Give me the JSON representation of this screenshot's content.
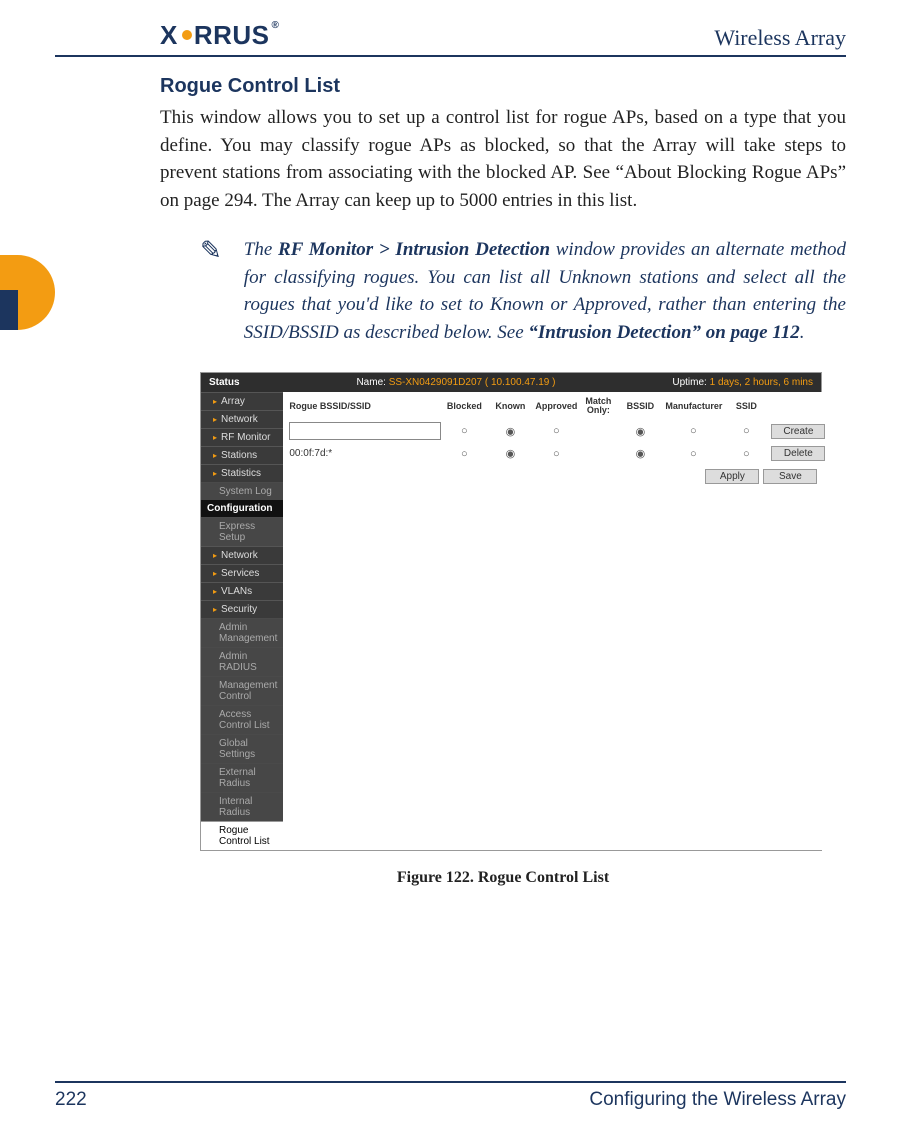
{
  "header": {
    "brand_left": "X",
    "brand_right": "RRUS",
    "product": "Wireless Array"
  },
  "section_title": "Rogue Control List",
  "body_paragraph": "This window allows you to set up a control list for rogue APs, based on a type that you define. You may classify rogue APs as blocked, so that the Array will take steps to prevent stations from associating with the blocked AP. See “About Blocking Rogue APs” on page 294. The Array can keep up to 5000 entries in this list.",
  "note": {
    "pre": "The ",
    "bold1": "RF Monitor > Intrusion Detection",
    "mid": " window provides an alternate method for classifying rogues. You can list all Unknown stations and select all the rogues that you'd like to set to Known or Approved, rather than entering the SSID/BSSID as described below. See ",
    "bold2": "“Intrusion Detection” on page 112",
    "post": "."
  },
  "screenshot": {
    "status_label": "Status",
    "name_label": "Name:",
    "name_value": "SS-XN0429091D207   ( 10.100.47.19 )",
    "uptime_label": "Uptime:",
    "uptime_value": "1 days, 2 hours, 6 mins",
    "sidebar_status": [
      "Array",
      "Network",
      "RF Monitor",
      "Stations",
      "Statistics"
    ],
    "sidebar_status_sub": "System Log",
    "config_label": "Configuration",
    "sidebar_config": [
      "Network",
      "Services",
      "VLANs",
      "Security"
    ],
    "config_first_sub": "Express Setup",
    "security_subs": [
      "Admin Management",
      "Admin RADIUS",
      "Management Control",
      "Access Control List",
      "Global Settings",
      "External Radius",
      "Internal Radius"
    ],
    "selected_item": "Rogue Control List",
    "columns": {
      "c1": "Rogue BSSID/SSID",
      "c2": "Blocked",
      "c3": "Known",
      "c4": "Approved",
      "c5a": "Match",
      "c5b": "Only:",
      "c6": "BSSID",
      "c7": "Manufacturer",
      "c8": "SSID"
    },
    "row2_label": "00:0f:7d:*",
    "buttons": {
      "create": "Create",
      "delete": "Delete",
      "apply": "Apply",
      "save": "Save"
    }
  },
  "caption": "Figure 122. Rogue Control List",
  "footer": {
    "page": "222",
    "chapter": "Configuring the Wireless Array"
  }
}
